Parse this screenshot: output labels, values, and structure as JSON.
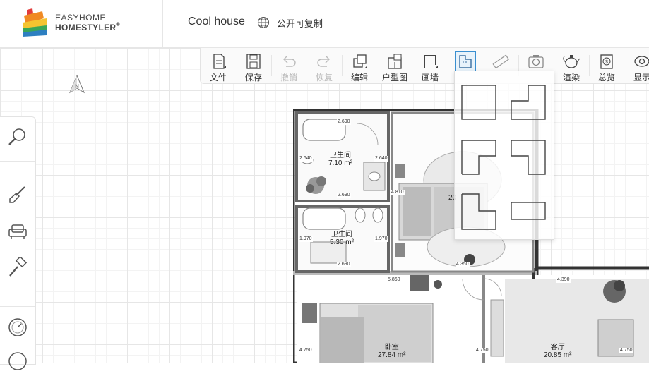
{
  "header": {
    "logo_line1": "EASYHOME",
    "logo_line2": "HOMESTYLER",
    "logo_mark": "®",
    "design_name": "Cool house",
    "share_label": "公开可复制"
  },
  "toolbar": {
    "items": [
      {
        "label": "文件",
        "icon": "file-icon",
        "disabled": false
      },
      {
        "label": "保存",
        "icon": "save-icon",
        "disabled": false
      },
      {
        "label": "撤销",
        "icon": "undo-icon",
        "disabled": true
      },
      {
        "label": "恢复",
        "icon": "redo-icon",
        "disabled": true
      },
      {
        "label": "编辑",
        "icon": "edit-icon",
        "disabled": false
      },
      {
        "label": "户型图",
        "icon": "floorplan-icon",
        "disabled": false
      },
      {
        "label": "画墙",
        "icon": "draw-wall-icon",
        "disabled": false
      },
      {
        "label": "",
        "icon": "room-template-icon",
        "disabled": false,
        "active": true
      },
      {
        "label": "",
        "icon": "ruler-icon",
        "disabled": true
      },
      {
        "label": "",
        "icon": "camera-icon",
        "disabled": true
      },
      {
        "label": "渲染",
        "icon": "render-icon",
        "disabled": false
      },
      {
        "label": "总览",
        "icon": "overview-icon",
        "disabled": false
      },
      {
        "label": "显示",
        "icon": "display-icon",
        "disabled": false
      }
    ]
  },
  "dropdown": {
    "shapes": [
      "square-room",
      "notched-room",
      "l-shape-room",
      "reverse-l-room",
      "l-shape-bottom-room",
      "rectangle-room"
    ]
  },
  "sidebar": {
    "buttons": [
      "search-icon",
      "shovel-icon",
      "armchair-icon",
      "paint-roller-icon",
      "compass-dial-icon",
      "more-icon"
    ]
  },
  "compass": {
    "label": "N"
  },
  "plan": {
    "rooms": [
      {
        "name": "卫生间",
        "area": "7.10 m²"
      },
      {
        "name": "卫生间",
        "area": "5.30 m²"
      },
      {
        "name": "卧室",
        "area": "27.84 m²"
      },
      {
        "name": "客厅",
        "area": "20.85 m²"
      },
      {
        "name": "",
        "area": "20"
      }
    ],
    "dimensions": [
      "2.690",
      "2.640",
      "2.640",
      "2.690",
      "4.810",
      "1.970",
      "1.970",
      "2.690",
      "4.350",
      "5.860",
      "4.390",
      "4.750",
      "4.750",
      "4.750"
    ]
  }
}
